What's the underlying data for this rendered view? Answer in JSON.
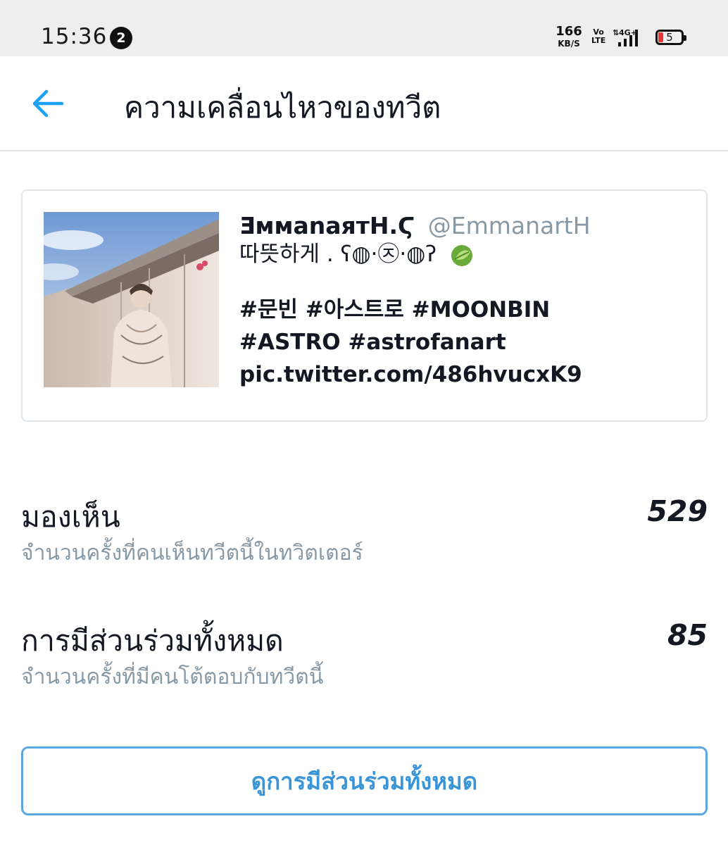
{
  "status_bar": {
    "time": "15:36",
    "notification_count": "2",
    "net_speed_value": "166",
    "net_speed_unit": "KB/S",
    "volte_top": "Vo",
    "volte_bottom": "LTE",
    "network_type": "4G+",
    "battery_level": "5",
    "battery_color": "#e53935"
  },
  "header": {
    "title": "ความเคลื่อนไหวของทวีต",
    "back_icon": "arrow-left-icon",
    "accent_color": "#1da1f2"
  },
  "tweet": {
    "author_name": "ƎммаnаятΗ.Ϛ",
    "author_handle": "@EmmanartH",
    "line1": "따뜻하게 . ʕ◍·㉨·◍ʔ",
    "line1_icon": "leaf-icon",
    "line2": "#문빈 #아스트로 #MOONBIN",
    "line3": "#ASTRO #astrofanart",
    "line4": "pic.twitter.com/486hvucxK9"
  },
  "metrics": [
    {
      "label": "มองเห็น",
      "description": "จำนวนครั้งที่คนเห็นทวีตนี้ในทวิตเตอร์",
      "value": "529"
    },
    {
      "label": "การมีส่วนร่วมทั้งหมด",
      "description": "จำนวนครั้งที่มีคนโต้ตอบกับทวีตนี้",
      "value": "85"
    }
  ],
  "engagement_button": {
    "label": "ดูการมีส่วนร่วมทั้งหมด"
  }
}
